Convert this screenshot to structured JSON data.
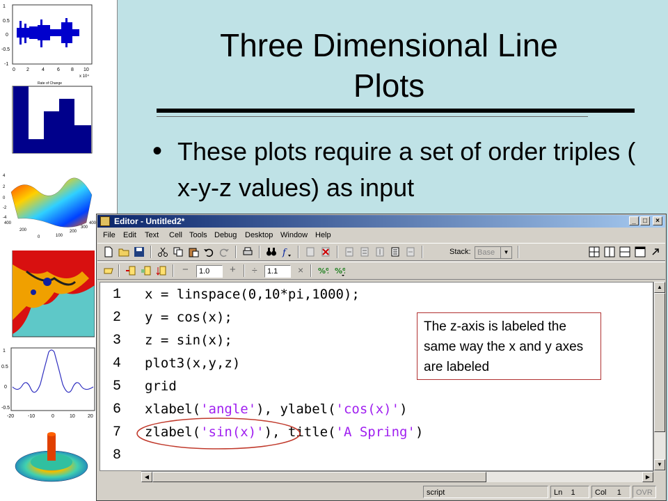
{
  "slide": {
    "title": "Three Dimensional Line Plots",
    "bullet": "These plots require a set of order triples ( x-y-z values) as input"
  },
  "thumbnails": {
    "wave": {
      "icon": "waveform-plot-icon",
      "ytick_labels": [
        "1",
        "0.5",
        "0",
        "-0.5",
        "-1"
      ],
      "xtick_labels": [
        "0",
        "2",
        "4",
        "6",
        "8",
        "10"
      ],
      "exponent": "x 10⁴"
    },
    "bar": {
      "icon": "bar-chart-icon",
      "title": "Rate of Change"
    },
    "surface": {
      "icon": "3d-surface-plot-icon",
      "ytick_labels": [
        "4",
        "2",
        "0",
        "-2",
        "-4"
      ],
      "xtick_labels": [
        "400",
        "200",
        "0",
        "100",
        "200",
        "300",
        "400"
      ]
    },
    "fractal": {
      "icon": "fractal-image-icon"
    },
    "sinc": {
      "icon": "sinc-line-plot-icon",
      "ytick_labels": [
        "1",
        "0.5",
        "0",
        "-0.5"
      ],
      "xtick_labels": [
        "-20",
        "-10",
        "0",
        "10",
        "20"
      ]
    },
    "mesh": {
      "icon": "3d-mesh-icon"
    }
  },
  "editor": {
    "title": "Editor - Untitled2*",
    "menu": [
      "File",
      "Edit",
      "Text",
      "Cell",
      "Tools",
      "Debug",
      "Desktop",
      "Window",
      "Help"
    ],
    "toolbar": {
      "stack_label": "Stack:",
      "stack_value": "Base",
      "cell_minus": "−",
      "cell_value_1": "1.0",
      "cell_plus": "+",
      "cell_divide": "÷",
      "cell_value_2": "1.1",
      "cell_times": "×"
    },
    "line_numbers": [
      "1",
      "2",
      "3",
      "4",
      "5",
      "6",
      "7",
      "8"
    ],
    "code": [
      {
        "text": "x = linspace(0,10*pi,1000);"
      },
      {
        "text": "y = cos(x);"
      },
      {
        "text": "z = sin(x);"
      },
      {
        "text": "plot3(x,y,z)"
      },
      {
        "text": "grid"
      },
      {
        "pre": "xlabel(",
        "s1": "'angle'",
        "mid": "), ylabel(",
        "s2": "'cos(x)'",
        "post": ")"
      },
      {
        "pre": "zlabel(",
        "s1": "'sin(x)'",
        "mid": "), title(",
        "s2": "'A Spring'",
        "post": ")"
      },
      {
        "text": ""
      }
    ],
    "status": {
      "mode": "script",
      "ln_label": "Ln",
      "ln_value": "1",
      "col_label": "Col",
      "col_value": "1",
      "ovr": "OVR"
    }
  },
  "callout": "The z-axis is labeled the same way the x and y axes are labeled",
  "colors": {
    "slide_bg": "#bfe2e6",
    "string_literal": "#a020f0",
    "titlebar_start": "#0a246a",
    "titlebar_end": "#a6caf0",
    "annotation_red": "#c0392b"
  }
}
